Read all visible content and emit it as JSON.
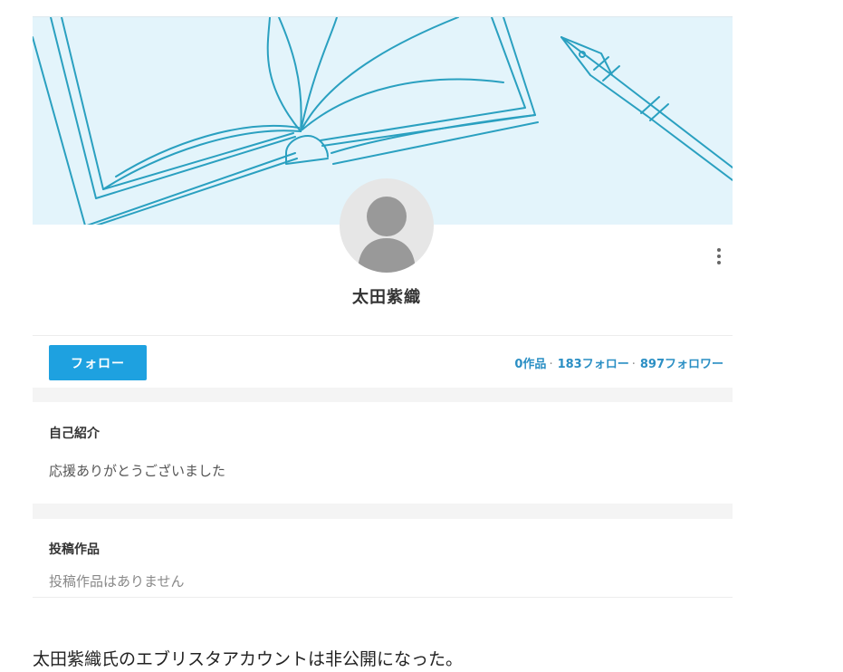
{
  "profile": {
    "username": "太田紫織"
  },
  "actions": {
    "follow_label": "フォロー",
    "stats": {
      "works": "0作品",
      "following": "183フォロー",
      "followers": "897フォロワー",
      "separator": "·"
    }
  },
  "intro": {
    "title": "自己紹介",
    "text": "応援ありがとうございました"
  },
  "works": {
    "title": "投稿作品",
    "text": "投稿作品はありません"
  },
  "caption": "太田紫織氏のエブリスタアカウントは非公開になった。",
  "colors": {
    "accent": "#1ea1e0",
    "stats_text": "#2b8fc4",
    "cover_bg": "#e3f4fb",
    "cover_line": "#2aa0c0"
  },
  "icons": {
    "menu": "more-vertical-icon",
    "avatar": "default-user-icon"
  }
}
